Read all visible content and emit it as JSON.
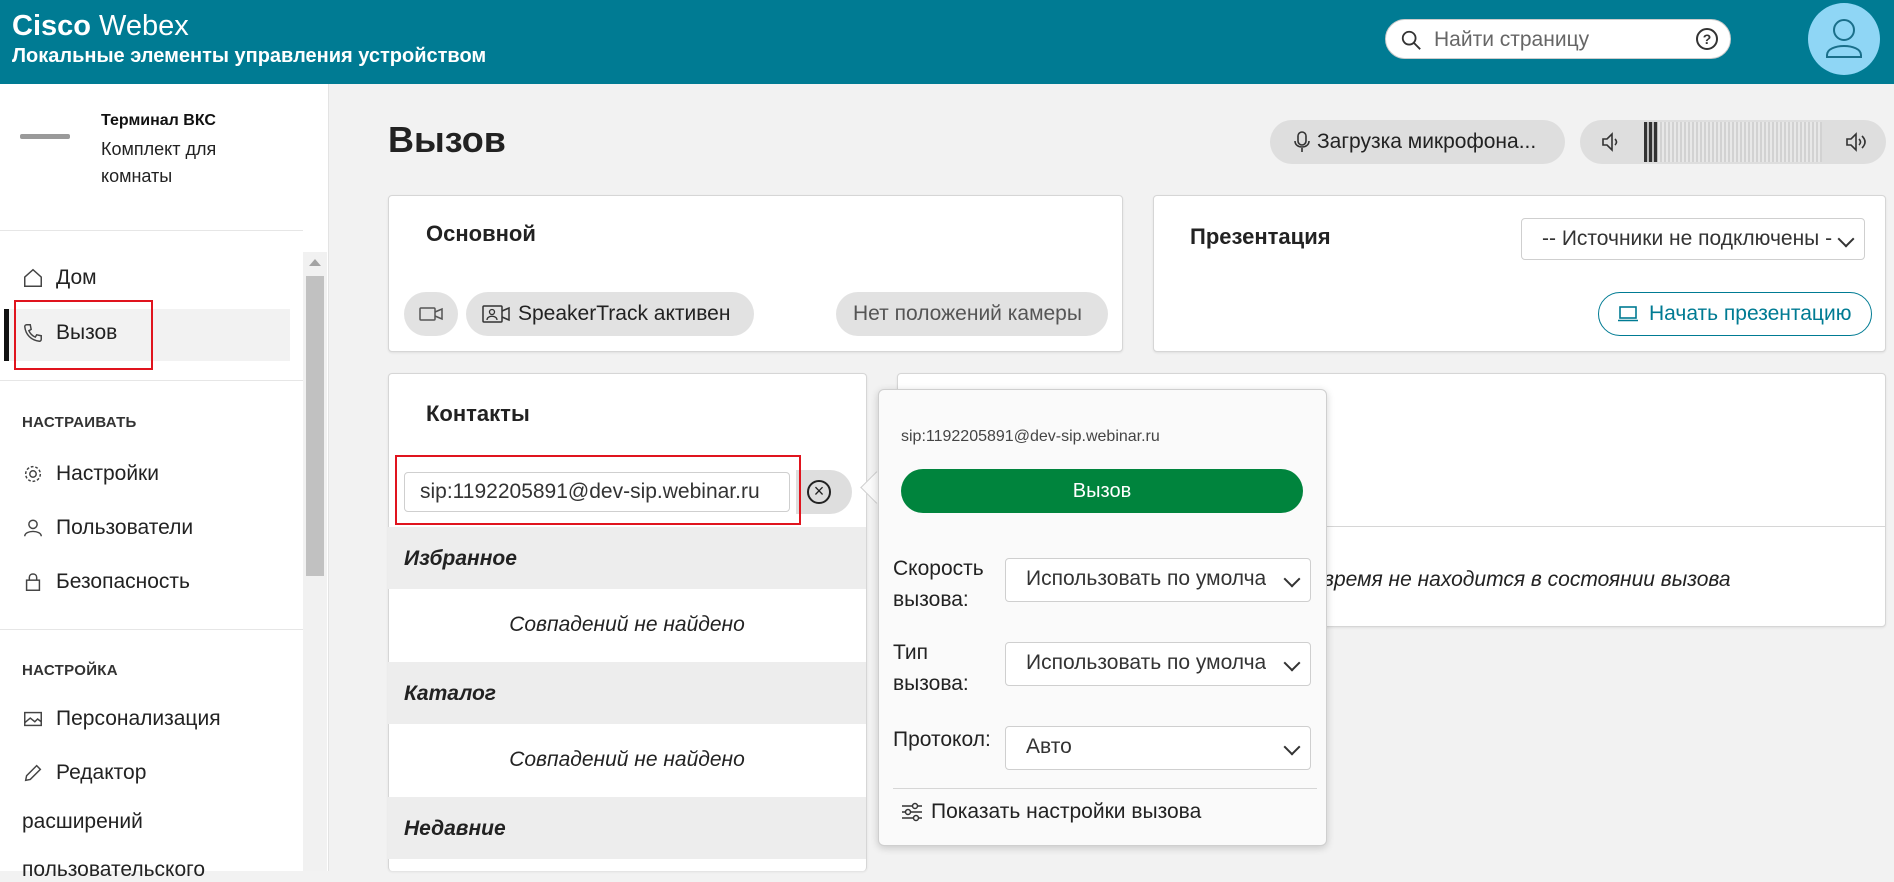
{
  "header": {
    "brand_bold": "Cisco",
    "brand_light": "Webex",
    "subtitle": "Локальные элементы управления устройством",
    "search_placeholder": "Найти страницу",
    "help_label": "?"
  },
  "sidebar": {
    "device_title": "Терминал ВКС",
    "device_subtitle": "Комплект для комнаты",
    "nav_main": [
      {
        "label": "Дом",
        "icon": "home-icon"
      },
      {
        "label": "Вызов",
        "icon": "phone-icon",
        "active": true
      }
    ],
    "section_customize": "НАСТРАИВАТЬ",
    "nav_customize": [
      {
        "label": "Настройки",
        "icon": "gear-icon"
      },
      {
        "label": "Пользователи",
        "icon": "user-icon"
      },
      {
        "label": "Безопасность",
        "icon": "lock-icon"
      }
    ],
    "section_setup": "НАСТРОЙКА",
    "nav_setup": [
      {
        "label": "Персонализация",
        "icon": "image-icon"
      },
      {
        "label": "Редактор",
        "icon": "pencil-icon"
      }
    ],
    "nav_setup_cont": "расширений",
    "nav_setup_cont2": "пользовательского"
  },
  "main": {
    "title": "Вызов",
    "mic_button": "Загрузка микрофона...",
    "volume_level": 0.08,
    "primary_card": {
      "title": "Основной",
      "speakertrack": "SpeakerTrack активен",
      "camera_positions": "Нет положений камеры"
    },
    "presentation_card": {
      "title": "Презентация",
      "source_select": "-- Источники не подключены --",
      "start_button": "Начать презентацию"
    },
    "contacts": {
      "title": "Контакты",
      "input_value": "sip:1192205891@dev-sip.webinar.ru",
      "favorites": "Избранное",
      "catalog": "Каталог",
      "recent": "Недавние",
      "no_results": "Совпадений не найдено"
    },
    "status_text": "время не находится в состоянии вызова"
  },
  "popup": {
    "address": "sip:1192205891@dev-sip.webinar.ru",
    "call_button": "Вызов",
    "speed_label_1": "Скорость",
    "speed_label_2": "вызова:",
    "speed_value": "Использовать по умолчанию",
    "type_label_1": "Тип",
    "type_label_2": "вызова:",
    "type_value": "Использовать по умолчанию",
    "protocol_label": "Протокол:",
    "protocol_value": "Авто",
    "show_settings": "Показать настройки вызова"
  },
  "colors": {
    "header": "#007b93",
    "call_button": "#00843d",
    "highlight": "#e0141e",
    "avatar": "#8fd6f5"
  }
}
